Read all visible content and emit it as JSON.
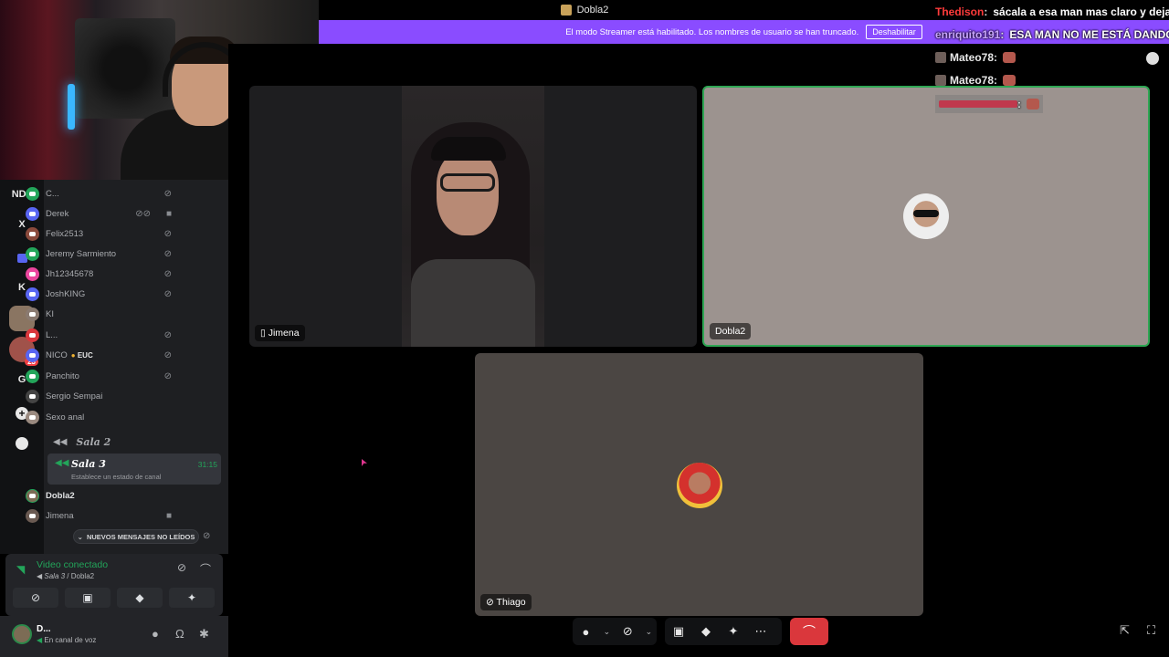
{
  "window": {
    "title": "Dobla2"
  },
  "banner": {
    "text": "El modo Streamer está habilitado. Los nombres de usuario se han truncado.",
    "button": "Deshabilitar"
  },
  "servers": [
    {
      "label": "NDF"
    },
    {
      "label": "X"
    },
    {
      "label": "K"
    },
    {
      "label": "G"
    }
  ],
  "server_badge": "23",
  "members": [
    {
      "name": "C...",
      "color": "#23a55a"
    },
    {
      "name": "Derek",
      "color": "#5865f2"
    },
    {
      "name": "Felix2513",
      "color": "#8b4a3c"
    },
    {
      "name": "Jeremy Sarmiento",
      "color": "#23a55a"
    },
    {
      "name": "Jh12345678",
      "color": "#eb459e"
    },
    {
      "name": "JoshKING",
      "color": "#5865f2"
    },
    {
      "name": "KI",
      "color": "#8a7a70"
    },
    {
      "name": "L...",
      "color": "#da373c"
    },
    {
      "name": "NICO",
      "color": "#5865f2",
      "tag": "EUC"
    },
    {
      "name": "Panchito",
      "color": "#23a55a"
    },
    {
      "name": "Sergio Sempai",
      "color": "#444"
    },
    {
      "name": "Sexo anal",
      "color": "#9a8a80"
    }
  ],
  "rooms": {
    "room2": "Sala 2",
    "room3": "Sala 3",
    "room3_time": "31:15",
    "room3_status": "Establece un estado de canal"
  },
  "room3_members": [
    {
      "name": "Dobla2"
    },
    {
      "name": "Jimena"
    }
  ],
  "new_messages": "NUEVOS MENSAJES NO LEÍDOS",
  "voice": {
    "title": "Video conectado",
    "room": "Sala 3",
    "server": "Dobla2"
  },
  "user": {
    "name": "D...",
    "status": "En canal de voz"
  },
  "tiles": {
    "jimena": "Jimena",
    "dobla": "Dobla2",
    "thiago": "Thiago"
  },
  "chat": [
    {
      "user": "Thedison",
      "text": "sácala a esa man mas claro y deja"
    },
    {
      "user": "enriquito191",
      "text": "ESA MAN NO ME ESTÁ DANDO"
    },
    {
      "user": "Mateo78"
    },
    {
      "user": "Mateo78"
    }
  ],
  "colors": {
    "accent": "#8a4cff",
    "connected": "#23a55a",
    "danger": "#da373c"
  }
}
